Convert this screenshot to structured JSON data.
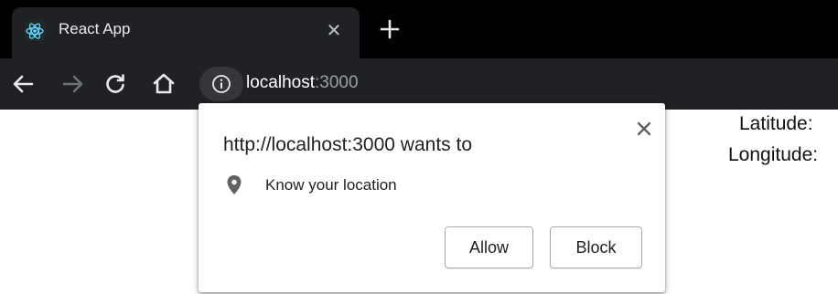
{
  "tab": {
    "title": "React App",
    "favicon": "react-logo-icon",
    "close_glyph": "✕",
    "new_tab": "new-tab-icon"
  },
  "toolbar": {
    "back": "back-arrow-icon",
    "forward": "forward-arrow-icon",
    "reload": "reload-icon",
    "home": "home-icon",
    "site_info": "info-icon",
    "url_host": "localhost",
    "url_port": ":3000"
  },
  "popup": {
    "title": "http://localhost:3000 wants to",
    "permission_label": "Know your location",
    "permission_icon": "location-pin-icon",
    "allow_label": "Allow",
    "block_label": "Block",
    "close": "close-icon"
  },
  "page": {
    "latitude_label": "Latitude:",
    "longitude_label": "Longitude:"
  },
  "colors": {
    "tabstrip": "#000000",
    "toolbar": "#202124",
    "site_info_pill": "#35363a",
    "url_port": "#9aa0a6"
  }
}
